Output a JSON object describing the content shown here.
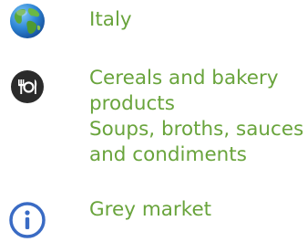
{
  "country": {
    "icon": "globe-icon",
    "label": "Italy"
  },
  "categories": {
    "icon": "food-plate-icon",
    "items": [
      {
        "lines": [
          "Cereals and bakery",
          "products"
        ]
      },
      {
        "lines": [
          "Soups, broths, sauces",
          "and condiments"
        ]
      }
    ]
  },
  "market": {
    "icon": "info-icon",
    "label": "Grey market"
  },
  "colors": {
    "text_green": "#69a43c",
    "icon_dark": "#2b2b2b",
    "info_blue": "#3a6bc4"
  }
}
